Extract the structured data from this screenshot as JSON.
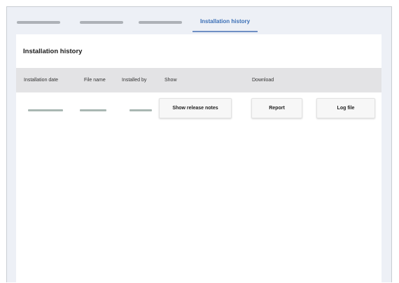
{
  "tabs": {
    "active_label": "Installation history"
  },
  "panel": {
    "title": "Installation history"
  },
  "table": {
    "columns": [
      "Installation date",
      "File name",
      "Installed by",
      "Show",
      "Download"
    ]
  },
  "row": {
    "show_release_notes_label": "Show release notes",
    "report_label": "Report",
    "log_file_label": "Log file"
  }
}
